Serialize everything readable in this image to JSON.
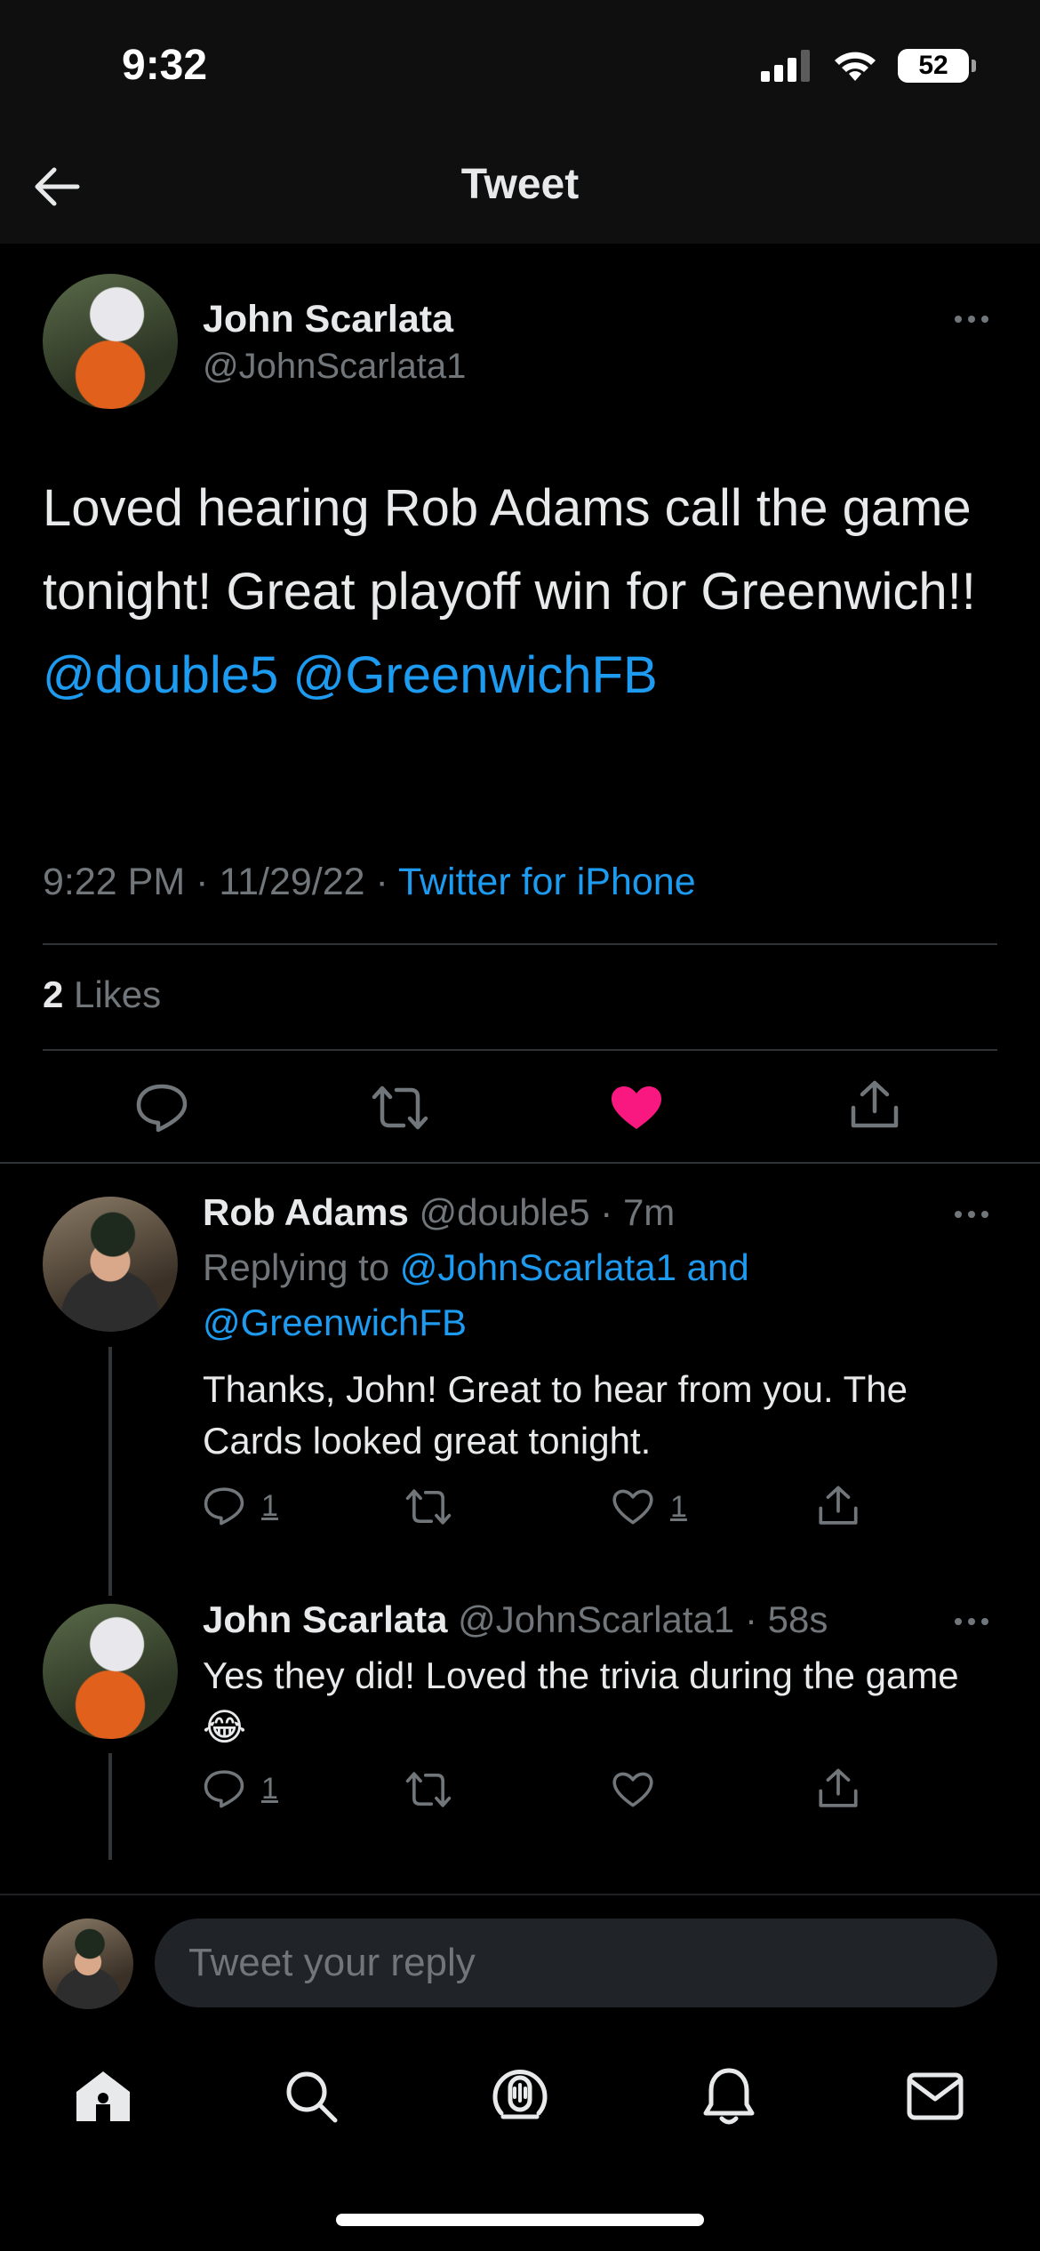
{
  "status_bar": {
    "time": "9:32",
    "battery": "52"
  },
  "header": {
    "title": "Tweet"
  },
  "main_tweet": {
    "author": "John Scarlata",
    "handle": "@JohnScarlata1",
    "text_plain": "Loved hearing Rob Adams call the game tonight! Great playoff win for Greenwich!!",
    "mention_1": "@double5",
    "mention_2": "@GreenwichFB",
    "time": "9:22 PM",
    "date": "11/29/22",
    "source": "Twitter for iPhone",
    "likes_count": "2",
    "likes_label": "Likes",
    "liked": true
  },
  "replies": [
    {
      "author": "Rob Adams",
      "handle": "@double5",
      "age": "7m",
      "replying_to_prefix": "Replying to",
      "replying_to_1": "@JohnScarlata1 and",
      "replying_to_2": "@GreenwichFB",
      "text": "Thanks, John! Great to hear from you. The Cards looked great tonight.",
      "reply_count": "1",
      "retweet_count": "",
      "like_count": "1"
    },
    {
      "author": "John Scarlata",
      "handle": "@JohnScarlata1",
      "age": "58s",
      "text": "Yes they did! Loved the trivia during the game😂",
      "reply_count": "1",
      "retweet_count": "",
      "like_count": ""
    }
  ],
  "composer": {
    "placeholder": "Tweet your reply"
  },
  "tabbar": {
    "items": [
      "home-icon",
      "search-icon",
      "spaces-icon",
      "notifications-icon",
      "messages-icon"
    ]
  },
  "colors": {
    "accent": "#1d9bf0",
    "like": "#f91880",
    "background": "#000000",
    "secondary_text": "#71767b"
  }
}
